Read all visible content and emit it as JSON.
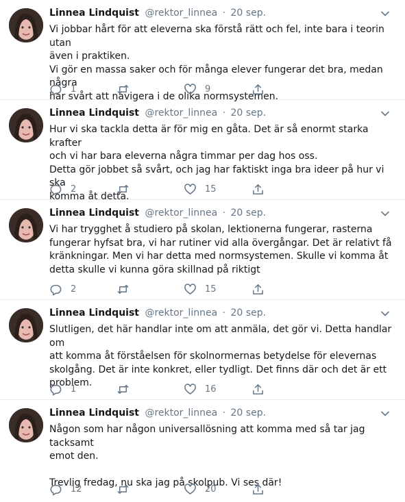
{
  "tweets": [
    {
      "author": "Linnea Lindquist",
      "handle": "@rektor_linnea",
      "separator": "·",
      "date": "20 sep.",
      "text": "Vi jobbar hårt för att eleverna ska förstå rätt och fel, inte bara i teorin utan\näven i praktiken.\nVi gör en massa saker och för många elever fungerar det bra, medan några\nhar svårt att navigera i de olika normsystemen.",
      "replies": "1",
      "retweets": "",
      "likes": "9"
    },
    {
      "author": "Linnea Lindquist",
      "handle": "@rektor_linnea",
      "separator": "·",
      "date": "20 sep.",
      "text": "Hur vi ska tackla detta är för mig en gåta. Det är så enormt starka krafter\noch vi har bara eleverna några timmar per dag hos oss.\nDetta gör jobbet så svårt, och jag har faktiskt inga bra ideer på hur vi ska\nkomma åt detta.",
      "replies": "2",
      "retweets": "",
      "likes": "15"
    },
    {
      "author": "Linnea Lindquist",
      "handle": "@rektor_linnea",
      "separator": "·",
      "date": "20 sep.",
      "text": "Vi har trygghet å studiero på skolan, lektionerna fungerar, rasterna\nfungerar hyfsat bra, vi har rutiner vid alla övergångar. Det är relativt få\nkränkningar. Men vi har detta med normsystemen. Skulle vi komma åt\ndetta skulle vi kunna göra skillnad på riktigt",
      "replies": "2",
      "retweets": "",
      "likes": "15"
    },
    {
      "author": "Linnea Lindquist",
      "handle": "@rektor_linnea",
      "separator": "·",
      "date": "20 sep.",
      "text": "Slutligen, det här handlar inte om att anmäla, det gör vi. Detta handlar om\natt komma åt förståelsen för skolnormernas betydelse för elevernas\nskolgång. Det är inte konkret, eller tydligt. Det finns där och det är ett\nproblem.",
      "replies": "1",
      "retweets": "",
      "likes": "16"
    },
    {
      "author": "Linnea Lindquist",
      "handle": "@rektor_linnea",
      "separator": "·",
      "date": "20 sep.",
      "text": "Någon som har någon universallösning att komma med så tar jag tacksamt\nemot den.\n\nTrevlig fredag, nu ska jag på skolpub. Vi ses där!",
      "replies": "12",
      "retweets": "",
      "likes": "20"
    }
  ],
  "colors": {
    "text": "#14171a",
    "secondary": "#657786",
    "divider": "#e6ecf0"
  },
  "icons": [
    "reply-icon",
    "retweet-icon",
    "like-icon",
    "share-icon",
    "chevron-down-icon"
  ]
}
